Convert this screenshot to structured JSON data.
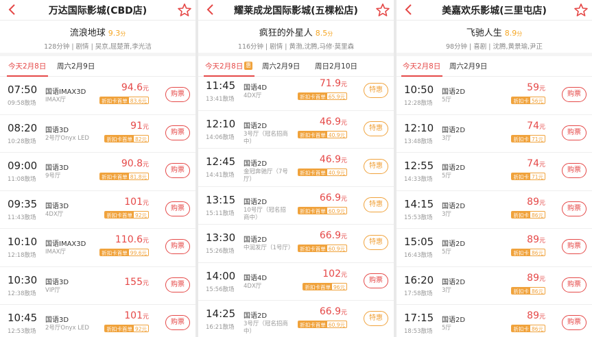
{
  "panels": [
    {
      "cinema": "万达国际影城(CBD店)",
      "movie": {
        "title": "流浪地球",
        "score": "9.3",
        "score_unit": "分",
        "meta": "128分钟 | 剧情 | 吴京,屈楚萧,李光洁"
      },
      "tabs": [
        {
          "label": "今天2月8日",
          "active": true
        },
        {
          "label": "周六2月9日",
          "active": false
        }
      ],
      "showtimes": [
        {
          "time": "07:50",
          "end": "09:58散场",
          "lang": "国语IMAX3D",
          "hall": "IMAX厅",
          "price": "94.6",
          "unit": "元",
          "disc_label": "折扣卡首单",
          "disc_value": "83.6元",
          "button": "购票"
        },
        {
          "time": "08:20",
          "end": "10:28散场",
          "lang": "国语3D",
          "hall": "2号厅Onyx LED",
          "price": "91",
          "unit": "元",
          "disc_label": "折扣卡首单",
          "disc_value": "82元",
          "button": "购票"
        },
        {
          "time": "09:00",
          "end": "11:08散场",
          "lang": "国语3D",
          "hall": "9号厅",
          "price": "90.8",
          "unit": "元",
          "disc_label": "折扣卡首单",
          "disc_value": "81.8元",
          "button": "购票"
        },
        {
          "time": "09:35",
          "end": "11:43散场",
          "lang": "国语3D",
          "hall": "4DX厅",
          "price": "101",
          "unit": "元",
          "disc_label": "折扣卡首单",
          "disc_value": "92元",
          "button": "购票"
        },
        {
          "time": "10:10",
          "end": "12:18散场",
          "lang": "国语IMAX3D",
          "hall": "IMAX厅",
          "price": "110.6",
          "unit": "元",
          "disc_label": "折扣卡首单",
          "disc_value": "99.6元",
          "button": "购票"
        },
        {
          "time": "10:30",
          "end": "12:38散场",
          "lang": "国语3D",
          "hall": "VIP厅",
          "price": "155",
          "unit": "元",
          "disc_label": "",
          "disc_value": "",
          "button": "购票"
        },
        {
          "time": "10:45",
          "end": "12:53散场",
          "lang": "国语3D",
          "hall": "2号厅Onyx LED",
          "price": "101",
          "unit": "元",
          "disc_label": "折扣卡首单",
          "disc_value": "92元",
          "button": "购票"
        }
      ]
    },
    {
      "cinema": "耀莱成龙国际影城(五棵松店)",
      "movie": {
        "title": "疯狂的外星人",
        "score": "8.5",
        "score_unit": "分",
        "meta": "116分钟 | 剧情 | 黄渤,沈腾,马修·莫里森"
      },
      "tabs": [
        {
          "label": "今天2月8日",
          "active": true,
          "badge": "惠"
        },
        {
          "label": "周六2月9日",
          "active": false
        },
        {
          "label": "周日2月10日",
          "active": false
        }
      ],
      "showtimes": [
        {
          "time": "11:45",
          "end": "13:41散场",
          "lang": "国语4D",
          "hall": "4DX厅",
          "price": "71.9",
          "unit": "元",
          "disc_label": "折扣卡首单",
          "disc_value": "65.9元",
          "button": "特惠",
          "special": true
        },
        {
          "time": "12:10",
          "end": "14:06散场",
          "lang": "国语2D",
          "hall": "3号厅（冠名招商中）",
          "price": "46.9",
          "unit": "元",
          "disc_label": "折扣卡首单",
          "disc_value": "40.9元",
          "button": "特惠",
          "special": true
        },
        {
          "time": "12:45",
          "end": "14:41散场",
          "lang": "国语2D",
          "hall": "金冠奔驰厅（7号厅）",
          "price": "46.9",
          "unit": "元",
          "disc_label": "折扣卡首单",
          "disc_value": "40.9元",
          "button": "特惠",
          "special": true
        },
        {
          "time": "13:15",
          "end": "15:11散场",
          "lang": "国语2D",
          "hall": "10号厅（冠名招商中）",
          "price": "66.9",
          "unit": "元",
          "disc_label": "折扣卡首单",
          "disc_value": "60.9元",
          "button": "特惠",
          "special": true
        },
        {
          "time": "13:30",
          "end": "15:26散场",
          "lang": "国语2D",
          "hall": "中润发厅（1号厅）",
          "price": "66.9",
          "unit": "元",
          "disc_label": "折扣卡首单",
          "disc_value": "60.9元",
          "button": "特惠",
          "special": true
        },
        {
          "time": "14:00",
          "end": "15:56散场",
          "lang": "国语4D",
          "hall": "4DX厅",
          "price": "102",
          "unit": "元",
          "disc_label": "折扣卡首单",
          "disc_value": "96元",
          "button": "购票",
          "special": false
        },
        {
          "time": "14:25",
          "end": "16:21散场",
          "lang": "国语2D",
          "hall": "3号厅（冠名招商中）",
          "price": "66.9",
          "unit": "元",
          "disc_label": "折扣卡首单",
          "disc_value": "60.9元",
          "button": "特惠",
          "special": true
        }
      ]
    },
    {
      "cinema": "美嘉欢乐影城(三里屯店)",
      "movie": {
        "title": "飞驰人生",
        "score": "8.9",
        "score_unit": "分",
        "meta": "98分钟 | 喜剧 | 沈腾,黄景瑜,尹正"
      },
      "tabs": [
        {
          "label": "今天2月8日",
          "active": true
        },
        {
          "label": "周六2月9日",
          "active": false
        }
      ],
      "showtimes": [
        {
          "time": "10:50",
          "end": "12:28散场",
          "lang": "国语2D",
          "hall": "5厅",
          "price": "59",
          "unit": "元",
          "disc_label": "折扣卡",
          "disc_value": "56元",
          "button": "购票"
        },
        {
          "time": "12:10",
          "end": "13:48散场",
          "lang": "国语2D",
          "hall": "3厅",
          "price": "74",
          "unit": "元",
          "disc_label": "折扣卡",
          "disc_value": "71元",
          "button": "购票"
        },
        {
          "time": "12:55",
          "end": "14:33散场",
          "lang": "国语2D",
          "hall": "5厅",
          "price": "74",
          "unit": "元",
          "disc_label": "折扣卡",
          "disc_value": "71元",
          "button": "购票"
        },
        {
          "time": "14:15",
          "end": "15:53散场",
          "lang": "国语2D",
          "hall": "3厅",
          "price": "89",
          "unit": "元",
          "disc_label": "折扣卡",
          "disc_value": "86元",
          "button": "购票"
        },
        {
          "time": "15:05",
          "end": "16:43散场",
          "lang": "国语2D",
          "hall": "5厅",
          "price": "89",
          "unit": "元",
          "disc_label": "折扣卡",
          "disc_value": "86元",
          "button": "购票"
        },
        {
          "time": "16:20",
          "end": "17:58散场",
          "lang": "国语2D",
          "hall": "3厅",
          "price": "89",
          "unit": "元",
          "disc_label": "折扣卡",
          "disc_value": "86元",
          "button": "购票"
        },
        {
          "time": "17:15",
          "end": "18:53散场",
          "lang": "国语2D",
          "hall": "5厅",
          "price": "89",
          "unit": "元",
          "disc_label": "折扣卡",
          "disc_value": "86元",
          "button": "购票"
        }
      ]
    }
  ],
  "colors": {
    "accent": "#e54847",
    "score": "#f5a623",
    "discount": "#f0a23b"
  },
  "icons": {
    "back": "chevron-left-icon",
    "favorite": "star-outline-icon"
  }
}
